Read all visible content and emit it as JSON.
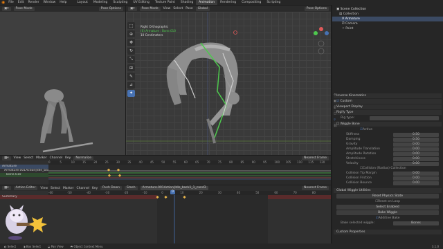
{
  "topbar": {
    "menus": [
      "File",
      "Edit",
      "Render",
      "Window",
      "Help"
    ],
    "tabs": [
      "Layout",
      "Modeling",
      "Sculpting",
      "UV Editing",
      "Texture Paint",
      "Shading",
      "Animation",
      "Rendering",
      "Compositing",
      "Scripting"
    ],
    "active_tab": "Animation",
    "scene": "Scene",
    "view_layer": "View Layer"
  },
  "left_viewport": {
    "mode": "Pose Mode",
    "options": "Pose Options"
  },
  "main_viewport": {
    "mode": "Pose Mode",
    "menus": [
      "View",
      "Select",
      "Pose"
    ],
    "orientation": "Global",
    "options": "Pose Options",
    "overlay": {
      "view": "Right Orthographic",
      "object": "(0) Armature : Bone.010",
      "scale": "10 Centimeters"
    }
  },
  "outliner": {
    "title": "Scene Collection",
    "items": [
      {
        "label": "Collection",
        "indent": 1
      },
      {
        "label": "Armature",
        "indent": 2,
        "selected": true
      },
      {
        "label": "Camera",
        "indent": 2
      },
      {
        "label": "Point",
        "indent": 2
      }
    ]
  },
  "properties": {
    "sections": [
      "Inverse Kinematics",
      "Custom",
      "Viewport Display",
      "Rigify Type"
    ],
    "custom_checked": "Custom",
    "rig_type_label": "Rig type:",
    "wiggle": {
      "title": "Wiggle Bone",
      "active": "Active",
      "fields": [
        {
          "label": "Stiffness",
          "value": "0.50"
        },
        {
          "label": "Damping",
          "value": "0.50"
        },
        {
          "label": "Gravity",
          "value": "0.00"
        },
        {
          "label": "Amplitude Translation",
          "value": "0.00"
        },
        {
          "label": "Amplitude Rotation",
          "value": "0.00"
        },
        {
          "label": "Stretchiness",
          "value": "0.00"
        },
        {
          "label": "Velocity",
          "value": "0.00"
        }
      ],
      "collision": "Collision (Radius) Collection",
      "fields2": [
        {
          "label": "Collision Tip Margin",
          "value": "0.00"
        },
        {
          "label": "Collision Friction",
          "value": "0.00"
        },
        {
          "label": "Collision Bounce",
          "value": "0.00"
        }
      ]
    },
    "global": {
      "title": "Global Wiggle Utilities",
      "buttons": [
        "Reset Physics State",
        "Select Enabled",
        "Bake Wiggle"
      ],
      "reset_on_loop": "Reset on Loop",
      "additive": "Additive Bake",
      "bake_label": "Bake selected wiggle:",
      "bake_value": "Bones"
    },
    "custom_props": "Custom Properties"
  },
  "graph": {
    "menus": [
      "View",
      "Select",
      "Marker",
      "Channel",
      "Key"
    ],
    "mode": "Normalize",
    "filter": "Nearest Frame",
    "ticks": [
      "0",
      "5",
      "10",
      "15",
      "20",
      "25",
      "30",
      "35",
      "40",
      "45",
      "50",
      "55",
      "60",
      "65",
      "70",
      "75",
      "80",
      "85",
      "90",
      "95",
      "100",
      "105",
      "110",
      "115",
      "120"
    ],
    "channels": [
      "Armature",
      "Armature.001Action|Idle_back1_1",
      "Bone.010"
    ]
  },
  "action": {
    "editor": "Action Editor",
    "menus": [
      "View",
      "Select",
      "Marker",
      "Channel",
      "Key"
    ],
    "push_down": "Push Down",
    "stash": "Stash",
    "action_name": "Armature.001Action|Idle_back1_1_cand3",
    "filter": "Nearest Frame",
    "summary": "Summary",
    "ticks": [
      "-60",
      "-50",
      "-40",
      "-30",
      "-20",
      "-10",
      "0",
      "10",
      "20",
      "30",
      "40",
      "50",
      "60",
      "70",
      "80"
    ],
    "current_frame": "0"
  },
  "status": {
    "items": [
      "Select",
      "Box Select",
      "Pan View",
      "Object Context Menu"
    ],
    "version": "3.1.0"
  },
  "colors": {
    "accent": "#4772b3",
    "selected": "#5680c2",
    "keyframe": "#e6b34a",
    "green_curve": "#4ec94e",
    "summary_row": "#5a2b2b"
  }
}
